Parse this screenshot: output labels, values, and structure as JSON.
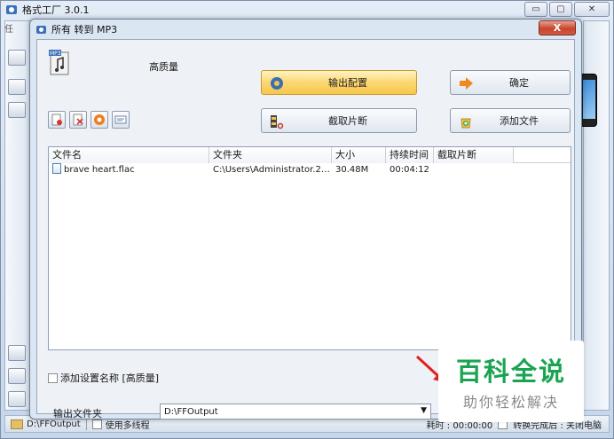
{
  "main_window": {
    "title": "格式工厂 3.0.1",
    "left_tab_char": "任",
    "status": {
      "path": "D:\\FFOutput",
      "multithread": "使用多线程",
      "elapsed": "耗时 : 00:00:00",
      "after_done": "转换完成后 : 关闭电脑"
    }
  },
  "dialog": {
    "title": "所有 转到 MP3",
    "close_label": "X",
    "quality": "高质量",
    "buttons": {
      "output_config": "输出配置",
      "ok": "确定",
      "clip": "截取片断",
      "add_file": "添加文件"
    },
    "table": {
      "columns": [
        "文件名",
        "文件夹",
        "大小",
        "持续时间",
        "截取片断"
      ],
      "rows": [
        {
          "name": "brave heart.flac",
          "folder": "C:\\Users\\Administrator.201...",
          "size": "30.48M",
          "duration": "00:04:12",
          "clip": ""
        }
      ]
    },
    "add_setting_name": "添加设置名称 [高质量]",
    "output_folder_label": "输出文件夹",
    "output_folder_value": "D:\\FFOutput"
  },
  "watermark": {
    "title": "百科全说",
    "subtitle": "助你轻松解决"
  },
  "colors": {
    "watermark_green": "#1aa452",
    "active_button": "#f8c74a"
  }
}
